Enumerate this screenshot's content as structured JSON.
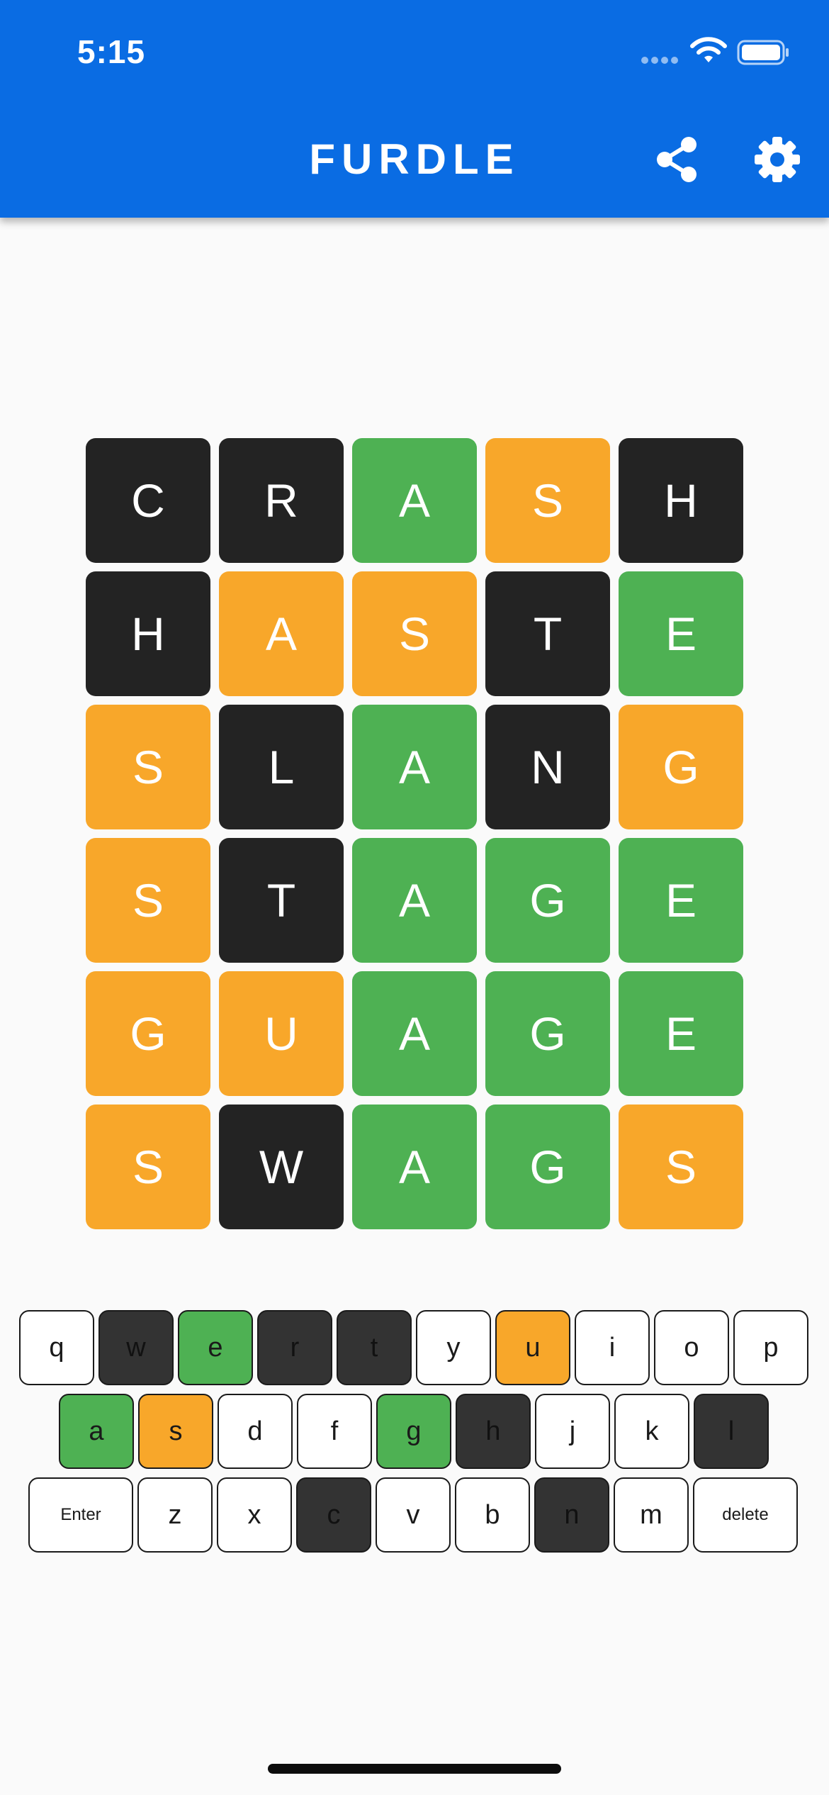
{
  "status_bar": {
    "time": "5:15",
    "icons": [
      "cellular-dots-icon",
      "wifi-icon",
      "battery-icon"
    ]
  },
  "app_bar": {
    "title": "FURDLE",
    "actions": [
      "share-icon",
      "settings-gear-icon"
    ],
    "background_color": "#0a6ce3"
  },
  "colors": {
    "absent": "#232323",
    "present": "#f8a72a",
    "correct": "#4eb153",
    "key_absent": "#333333",
    "key_default": "#ffffff"
  },
  "board": {
    "rows": [
      {
        "letters": [
          "C",
          "R",
          "A",
          "S",
          "H"
        ],
        "states": [
          "absent",
          "absent",
          "correct",
          "present",
          "absent"
        ]
      },
      {
        "letters": [
          "H",
          "A",
          "S",
          "T",
          "E"
        ],
        "states": [
          "absent",
          "present",
          "present",
          "absent",
          "correct"
        ]
      },
      {
        "letters": [
          "S",
          "L",
          "A",
          "N",
          "G"
        ],
        "states": [
          "present",
          "absent",
          "correct",
          "absent",
          "present"
        ]
      },
      {
        "letters": [
          "S",
          "T",
          "A",
          "G",
          "E"
        ],
        "states": [
          "present",
          "absent",
          "correct",
          "correct",
          "correct"
        ]
      },
      {
        "letters": [
          "G",
          "U",
          "A",
          "G",
          "E"
        ],
        "states": [
          "present",
          "present",
          "correct",
          "correct",
          "correct"
        ]
      },
      {
        "letters": [
          "S",
          "W",
          "A",
          "G",
          "S"
        ],
        "states": [
          "present",
          "absent",
          "correct",
          "correct",
          "present"
        ]
      }
    ]
  },
  "keyboard": {
    "rows": [
      [
        {
          "label": "q",
          "state": "default"
        },
        {
          "label": "w",
          "state": "absent"
        },
        {
          "label": "e",
          "state": "correct"
        },
        {
          "label": "r",
          "state": "absent"
        },
        {
          "label": "t",
          "state": "absent"
        },
        {
          "label": "y",
          "state": "default"
        },
        {
          "label": "u",
          "state": "present"
        },
        {
          "label": "i",
          "state": "default"
        },
        {
          "label": "o",
          "state": "default"
        },
        {
          "label": "p",
          "state": "default"
        }
      ],
      [
        {
          "label": "a",
          "state": "correct"
        },
        {
          "label": "s",
          "state": "present"
        },
        {
          "label": "d",
          "state": "default"
        },
        {
          "label": "f",
          "state": "default"
        },
        {
          "label": "g",
          "state": "correct"
        },
        {
          "label": "h",
          "state": "absent"
        },
        {
          "label": "j",
          "state": "default"
        },
        {
          "label": "k",
          "state": "default"
        },
        {
          "label": "l",
          "state": "absent"
        }
      ],
      [
        {
          "label": "Enter",
          "state": "default",
          "wide": true
        },
        {
          "label": "z",
          "state": "default"
        },
        {
          "label": "x",
          "state": "default"
        },
        {
          "label": "c",
          "state": "absent"
        },
        {
          "label": "v",
          "state": "default"
        },
        {
          "label": "b",
          "state": "default"
        },
        {
          "label": "n",
          "state": "absent"
        },
        {
          "label": "m",
          "state": "default"
        },
        {
          "label": "delete",
          "state": "default",
          "wide": true
        }
      ]
    ]
  }
}
